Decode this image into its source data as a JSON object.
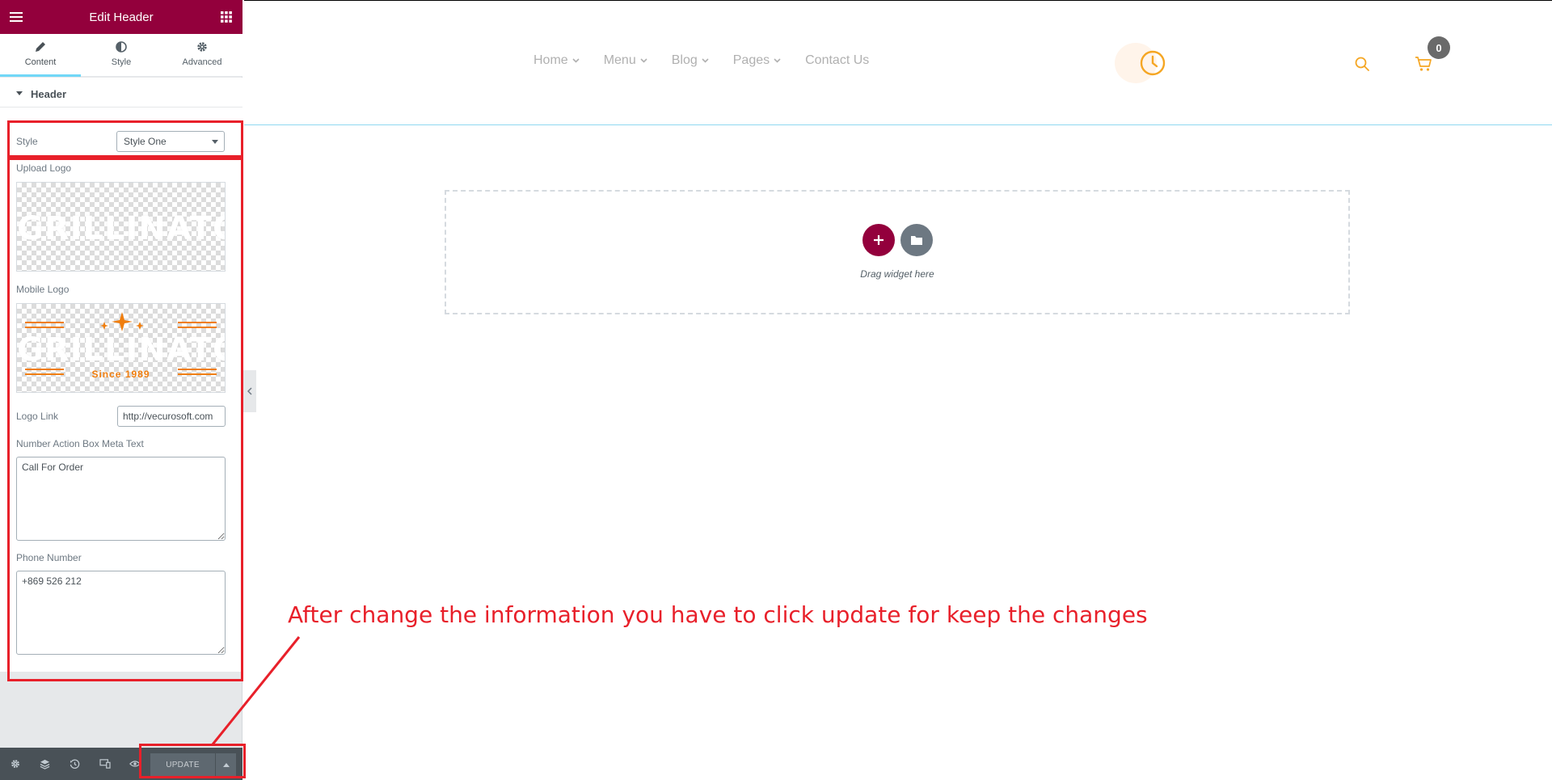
{
  "editor": {
    "title": "Edit Header",
    "tabs": [
      {
        "label": "Content",
        "icon": "pencil-icon",
        "active": true
      },
      {
        "label": "Style",
        "icon": "half-circle-icon",
        "active": false
      },
      {
        "label": "Advanced",
        "icon": "gear-icon",
        "active": false
      }
    ],
    "section": "Header",
    "controls": {
      "style_label": "Style",
      "style_value": "Style One",
      "upload_logo_label": "Upload Logo",
      "upload_logo_text": "GRILLINATOR",
      "mobile_logo_label": "Mobile Logo",
      "mobile_logo_text": "GRILLINATOR",
      "mobile_logo_tagline": "Since 1989",
      "logo_link_label": "Logo Link",
      "logo_link_value": "http://vecurosoft.com",
      "meta_text_label": "Number Action Box Meta Text",
      "meta_text_value": "Call For Order",
      "phone_label": "Phone Number",
      "phone_value": "+869 526 212"
    },
    "bottom_bar": {
      "icons": [
        "gear-icon",
        "layers-icon",
        "history-icon",
        "responsive-icon",
        "eye-icon"
      ],
      "update_label": "UPDATE"
    }
  },
  "annotation": {
    "text": "After change the information you have to click update for keep the changes",
    "color": "#e8202a"
  },
  "preview": {
    "nav": [
      {
        "label": "Home"
      },
      {
        "label": "Menu"
      },
      {
        "label": "Blog"
      },
      {
        "label": "Pages"
      },
      {
        "label": "Contact Us"
      }
    ],
    "cart_count": "0",
    "drop_zone_text": "Drag widget here"
  },
  "colors": {
    "brand": "#93003c",
    "accent_orange": "#f5a623",
    "logo_orange": "#f07e0e"
  }
}
